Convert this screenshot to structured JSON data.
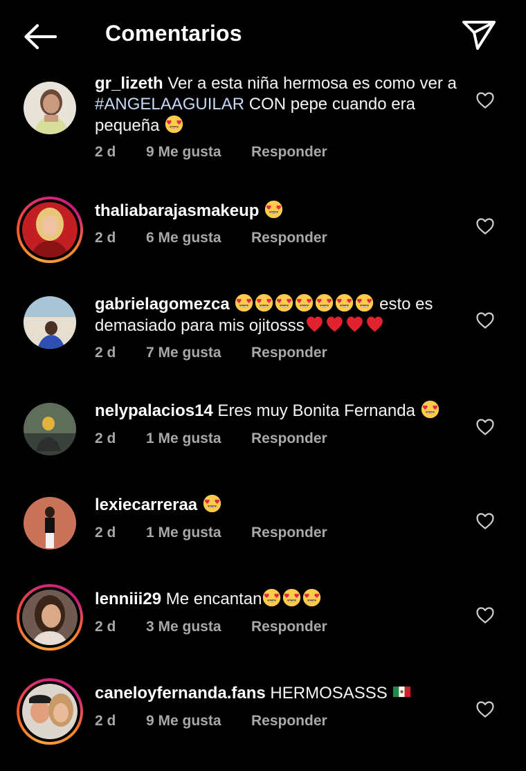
{
  "header": {
    "title": "Comentarios",
    "back_icon": "arrow-left-icon",
    "share_icon": "paper-plane-icon"
  },
  "colors": {
    "background": "#000000",
    "text": "#f5f5f5",
    "meta": "#a8a8a8",
    "hashtag": "#c7d8f5",
    "story_ring": [
      "#f7a33b",
      "#d62976"
    ]
  },
  "comments": [
    {
      "username": "gr_lizeth",
      "text_a": " Ver a esta niña hermosa es como ver a ",
      "hashtag": "#ANGELAAGUILAR",
      "text_b": " CON pepe cuando era pequeña",
      "emoji": "heart-eyes-emoji x1",
      "time": "2 d",
      "likes": "9 Me gusta",
      "reply": "Responder",
      "has_story_ring": false
    },
    {
      "username": "thaliabarajasmakeup",
      "text": "",
      "emoji": "heart-eyes-emoji x1",
      "time": "2 d",
      "likes": "6 Me gusta",
      "reply": "Responder",
      "has_story_ring": true
    },
    {
      "username": "gabrielagomezca",
      "text": "esto es demasiado para mis ojitosss",
      "emoji": "heart-eyes-emoji x7, red-heart-emoji x4",
      "time": "2 d",
      "likes": "7 Me gusta",
      "reply": "Responder",
      "has_story_ring": false
    },
    {
      "username": "nelypalacios14",
      "text": " Eres muy Bonita Fernanda",
      "emoji": "heart-eyes-emoji x1",
      "time": "2 d",
      "likes": "1 Me gusta",
      "reply": "Responder",
      "has_story_ring": false
    },
    {
      "username": "lexiecarreraa",
      "text": "",
      "emoji": "heart-eyes-emoji x1",
      "time": "2 d",
      "likes": "1 Me gusta",
      "reply": "Responder",
      "has_story_ring": false
    },
    {
      "username": "lenniii29",
      "text": " Me encantan",
      "emoji": "heart-eyes-emoji x3",
      "time": "2 d",
      "likes": "3 Me gusta",
      "reply": "Responder",
      "has_story_ring": true
    },
    {
      "username": "caneloyfernanda.fans",
      "text": " HERMOSASSS",
      "emoji": "mexico-flag-emoji x1",
      "time": "2 d",
      "likes": "9 Me gusta",
      "reply": "Responder",
      "has_story_ring": true
    }
  ]
}
